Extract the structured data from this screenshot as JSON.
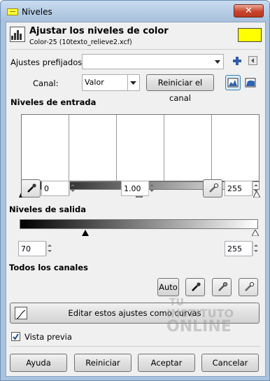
{
  "window": {
    "title": "Niveles",
    "close_label": "✕"
  },
  "header": {
    "title": "Ajustar los niveles de color",
    "subtitle": "Color-25 (10texto_relieve2.xcf)",
    "color_swatch": "#ffff00"
  },
  "presets": {
    "label": "Ajustes prefijados:",
    "value": ""
  },
  "channel": {
    "label": "Canal:",
    "value": "Valor",
    "reset_label": "Reiniciar el canal"
  },
  "input_levels": {
    "title": "Niveles de entrada",
    "low": "0",
    "gamma": "1.00",
    "high": "255"
  },
  "output_levels": {
    "title": "Niveles de salida",
    "low": "70",
    "high": "255"
  },
  "all_channels": {
    "title": "Todos los canales",
    "auto_label": "Auto"
  },
  "curves_button": {
    "label": "Editar estos ajustes como curvas"
  },
  "preview": {
    "label": "Vista previa",
    "checked": true
  },
  "watermark": {
    "line1": "TU",
    "line2": "INSTITUTO",
    "line3": "ONLINE"
  },
  "footer": {
    "help": "Ayuda",
    "reset": "Reiniciar",
    "accept": "Aceptar",
    "cancel": "Cancelar"
  },
  "colors": {
    "accent_yellow": "#ffff00",
    "title_blue": "#a9c3de",
    "close_red": "#c8442b"
  }
}
